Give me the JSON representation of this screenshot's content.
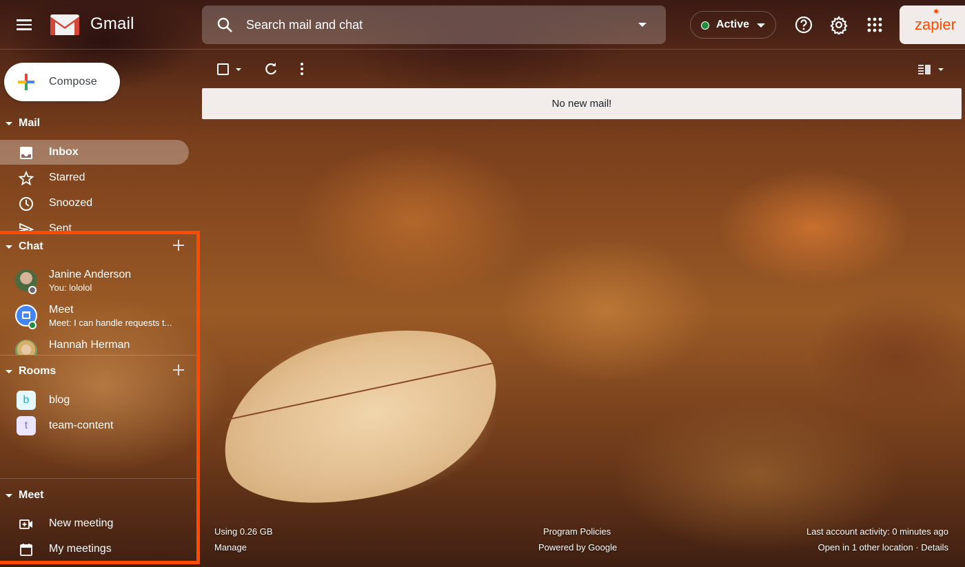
{
  "header": {
    "app_name": "Gmail",
    "search_placeholder": "Search mail and chat",
    "status_label": "Active",
    "status_color": "#1e8e3e",
    "icons": [
      "menu-icon",
      "gmail-logo",
      "search-icon",
      "search-options-icon",
      "help-icon",
      "settings-icon",
      "apps-icon"
    ],
    "brand_button": "zapier",
    "brand_color": "#ff4a00"
  },
  "compose": {
    "label": "Compose"
  },
  "mail": {
    "title": "Mail",
    "items": [
      {
        "label": "Inbox",
        "icon": "inbox-icon",
        "active": true
      },
      {
        "label": "Starred",
        "icon": "star-icon"
      },
      {
        "label": "Snoozed",
        "icon": "clock-icon"
      },
      {
        "label": "Sent",
        "icon": "send-icon"
      }
    ]
  },
  "chat": {
    "title": "Chat",
    "items": [
      {
        "name": "Janine Anderson",
        "snippet": "You: lololol",
        "presence": "away"
      },
      {
        "name": "Meet",
        "snippet": "Meet: I can handle requests t...",
        "presence": "online"
      },
      {
        "name": "Hannah Herman",
        "snippet": ""
      }
    ]
  },
  "rooms": {
    "title": "Rooms",
    "items": [
      {
        "name": "blog",
        "initial": "b"
      },
      {
        "name": "team-content",
        "initial": "t"
      }
    ]
  },
  "meet": {
    "title": "Meet",
    "items": [
      {
        "label": "New meeting",
        "icon": "video-add-icon"
      },
      {
        "label": "My meetings",
        "icon": "calendar-icon"
      }
    ]
  },
  "main": {
    "empty_message": "No new mail!"
  },
  "footer": {
    "storage": "Using 0.26 GB",
    "manage": "Manage",
    "program_policies": "Program Policies",
    "powered_by": "Powered by Google",
    "last_activity": "Last account activity: 0 minutes ago",
    "open_locations": "Open in 1 other location · Details"
  },
  "highlight_color": "#ff4a00"
}
